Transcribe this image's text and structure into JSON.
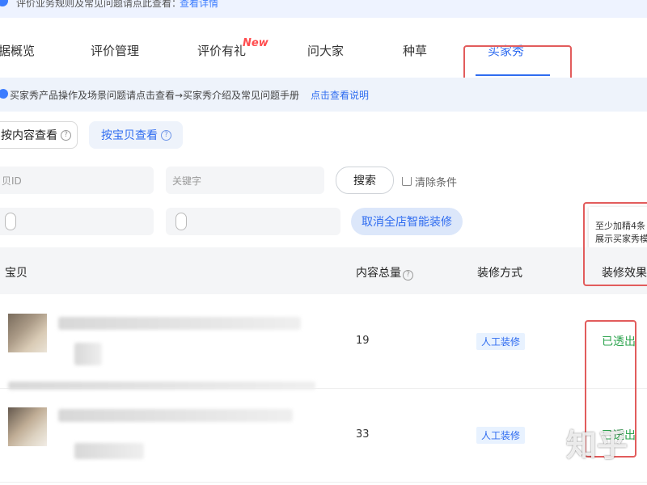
{
  "top_notice": {
    "text": "评价业务规则及常见问题请点此查看：",
    "link": "查看详情"
  },
  "tabs": [
    {
      "label": "据概览"
    },
    {
      "label": "评价管理"
    },
    {
      "label": "评价有礼"
    },
    {
      "label": "问大家"
    },
    {
      "label": "种草"
    },
    {
      "label": "买家秀",
      "active": true
    }
  ],
  "new_badge": "New",
  "info_bar": {
    "text": "买家秀产品操作及场景问题请点击查看→买家秀介绍及常见问题手册",
    "link": "点击查看说明"
  },
  "view_buttons": {
    "by_content": "按内容查看",
    "by_item": "按宝贝查看"
  },
  "filters": {
    "item_id_placeholder": "贝ID",
    "keyword_placeholder": "关键字",
    "search_button": "搜索",
    "clear_button": "清除条件",
    "cancel_smart_button": "取消全店智能装修"
  },
  "tooltip": {
    "line1": "至少加精4条",
    "line2": "展示买家秀模"
  },
  "table": {
    "headers": {
      "item": "宝贝",
      "total": "内容总量",
      "method": "装修方式",
      "effect": "装修效果"
    },
    "rows": [
      {
        "count": "19",
        "method": "人工装修",
        "effect": "已透出"
      },
      {
        "count": "33",
        "method": "人工装修",
        "effect": "已透出"
      }
    ]
  },
  "watermark": "知乎",
  "colors": {
    "accent": "#2f6cf0",
    "success": "#2ea44f",
    "highlight": "#e25c5c",
    "new_badge": "#ff4d4f"
  }
}
